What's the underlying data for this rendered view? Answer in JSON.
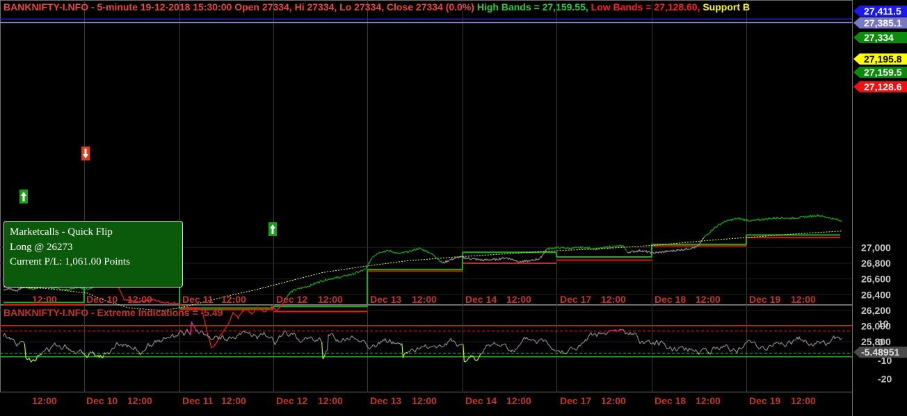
{
  "chart_data": [
    {
      "type": "line",
      "panel": "price",
      "header": {
        "symbol_title": "BANKNIFTY-I.NFO - 5-minute 19-12-2018 15:30:00 Open 27334, Hi 27334, Lo 27334, Close 27334 (0.0%)",
        "high_bands": "High Bands = 27,159.55,",
        "low_bands": "Low Bands = 27,128.60,",
        "support": "Support B"
      },
      "ylim": [
        25700,
        27450
      ],
      "y_ticks": [
        "27,000",
        "26,800",
        "26,600",
        "26,400",
        "26,200",
        "26,000",
        "25,800"
      ],
      "x_ticks": [
        "12:00",
        "Dec 10",
        "12:00",
        "Dec 11",
        "12:00",
        "Dec 12",
        "12:00",
        "Dec 13",
        "12:00",
        "Dec 14",
        "12:00",
        "Dec 17",
        "12:00",
        "Dec 18",
        "12:00",
        "Dec 19",
        "12:00"
      ],
      "price_tags": [
        {
          "label": "27,411.5",
          "bg": "#1a1aee",
          "fg": "#ffffff"
        },
        {
          "label": "27,385.1",
          "bg": "#7878c8",
          "fg": "#ffffff"
        },
        {
          "label": "27,334",
          "bg": "#0a8c0a",
          "fg": "#ffffff"
        },
        {
          "label": "27,195.8",
          "bg": "#ffff00",
          "fg": "#000000"
        },
        {
          "label": "27,159.5",
          "bg": "#0a8c0a",
          "fg": "#ffffff"
        },
        {
          "label": "27,128.6",
          "bg": "#ee1111",
          "fg": "#ffffff"
        }
      ],
      "blue_lines": [
        27411.5,
        27385.1
      ],
      "segments": [
        {
          "high": 26300,
          "low": 26270
        },
        {
          "high": 26560,
          "low": 26520
        },
        {
          "high": 26230,
          "low": 26210
        },
        {
          "high": 26250,
          "low": 26185
        },
        {
          "high": 26720,
          "low": 26700
        },
        {
          "high": 26940,
          "low": 26800
        },
        {
          "high": 26880,
          "low": 26840
        },
        {
          "high": 27040,
          "low": 27020
        },
        {
          "high": 27159.55,
          "low": 27128.6
        }
      ],
      "price_path": [
        [
          0,
          26460
        ],
        [
          3,
          26480
        ],
        [
          8,
          26450
        ],
        [
          12,
          26500
        ],
        [
          18,
          26470
        ],
        [
          24,
          26510
        ],
        [
          30,
          26480
        ],
        [
          38,
          26460
        ],
        [
          44,
          26490
        ],
        [
          50,
          26470
        ],
        [
          56,
          26520
        ],
        [
          62,
          26620
        ],
        [
          66,
          26720
        ],
        [
          68,
          26520
        ],
        [
          72,
          26330
        ],
        [
          80,
          26310
        ],
        [
          88,
          26340
        ],
        [
          96,
          26300
        ],
        [
          104,
          26290
        ],
        [
          108,
          26240
        ],
        [
          114,
          26220
        ],
        [
          118,
          26230
        ],
        [
          124,
          25720
        ],
        [
          126,
          25760
        ],
        [
          130,
          25900
        ],
        [
          134,
          26020
        ],
        [
          137,
          26180
        ],
        [
          140,
          26100
        ],
        [
          144,
          26230
        ],
        [
          148,
          26160
        ],
        [
          152,
          26240
        ],
        [
          156,
          26180
        ],
        [
          160,
          26250
        ],
        [
          163,
          26200
        ],
        [
          166,
          26270
        ],
        [
          168,
          26340
        ],
        [
          171,
          26430
        ],
        [
          175,
          26470
        ],
        [
          182,
          26510
        ],
        [
          188,
          26560
        ],
        [
          194,
          26600
        ],
        [
          200,
          26620
        ],
        [
          208,
          26660
        ],
        [
          216,
          26720
        ],
        [
          220,
          26880
        ],
        [
          224,
          26940
        ],
        [
          230,
          26960
        ],
        [
          236,
          26920
        ],
        [
          242,
          26950
        ],
        [
          248,
          26990
        ],
        [
          254,
          26940
        ],
        [
          258,
          26880
        ],
        [
          262,
          26800
        ],
        [
          266,
          26840
        ],
        [
          272,
          26880
        ],
        [
          278,
          26860
        ],
        [
          286,
          26840
        ],
        [
          294,
          26850
        ],
        [
          300,
          26870
        ],
        [
          308,
          26820
        ],
        [
          314,
          26830
        ],
        [
          320,
          26860
        ],
        [
          324,
          26980
        ],
        [
          330,
          27000
        ],
        [
          338,
          26990
        ],
        [
          346,
          27000
        ],
        [
          354,
          26980
        ],
        [
          362,
          27010
        ],
        [
          370,
          27020
        ],
        [
          372,
          26940
        ],
        [
          380,
          26960
        ],
        [
          388,
          26930
        ],
        [
          396,
          26950
        ],
        [
          404,
          26970
        ],
        [
          410,
          26990
        ],
        [
          414,
          27010
        ],
        [
          418,
          27130
        ],
        [
          424,
          27250
        ],
        [
          430,
          27330
        ],
        [
          438,
          27370
        ],
        [
          446,
          27340
        ],
        [
          454,
          27360
        ],
        [
          462,
          27380
        ],
        [
          470,
          27370
        ],
        [
          478,
          27390
        ],
        [
          486,
          27410
        ],
        [
          492,
          27380
        ],
        [
          500,
          27340
        ]
      ],
      "sma": [
        [
          0,
          26500
        ],
        [
          25,
          26480
        ],
        [
          50,
          26420
        ],
        [
          60,
          26330
        ],
        [
          75,
          26230
        ],
        [
          95,
          26200
        ],
        [
          105,
          26230
        ],
        [
          120,
          26310
        ],
        [
          135,
          26390
        ],
        [
          150,
          26460
        ],
        [
          170,
          26570
        ],
        [
          190,
          26680
        ],
        [
          215,
          26760
        ],
        [
          240,
          26830
        ],
        [
          270,
          26880
        ],
        [
          300,
          26920
        ],
        [
          330,
          26960
        ],
        [
          360,
          26990
        ],
        [
          390,
          27030
        ],
        [
          420,
          27090
        ],
        [
          445,
          27130
        ],
        [
          470,
          27170
        ],
        [
          500,
          27210
        ]
      ],
      "info_box": {
        "title": "Marketcalls - Quick Flip",
        "position": "Long @ 26273",
        "pl": "Current P/L: 1,061.00 Points"
      }
    },
    {
      "type": "line",
      "panel": "indicator",
      "title": "BANKNIFTY-I.NFO - Extreme Indications = -5.49",
      "ylim": [
        -27,
        17
      ],
      "y_ticks": [
        "10",
        "0",
        "-10",
        "-20"
      ],
      "upper_levels": [
        6,
        9
      ],
      "lower_levels": [
        -6,
        -8
      ],
      "last_value_tag": "-5.48951",
      "x_ticks": [
        "12:00",
        "Dec 10",
        "12:00",
        "Dec 11",
        "12:00",
        "Dec 12",
        "12:00",
        "Dec 13",
        "12:00",
        "Dec 14",
        "12:00",
        "Dec 17",
        "12:00",
        "Dec 18",
        "12:00",
        "Dec 19",
        "12:00"
      ]
    }
  ]
}
